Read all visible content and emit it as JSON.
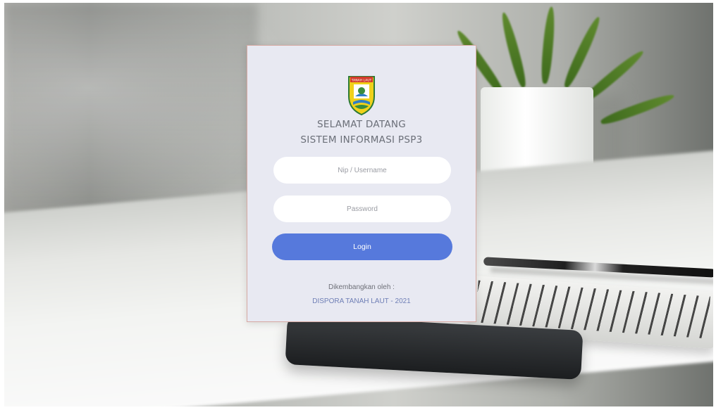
{
  "welcome": {
    "line1": "SELAMAT DATANG",
    "line2": "SISTEM INFORMASI PSP3"
  },
  "form": {
    "username_placeholder": "Nip / Username",
    "username_value": "",
    "password_placeholder": "Password",
    "password_value": "",
    "login_label": "Login"
  },
  "footer": {
    "developed_by_label": "Dikembangkan oleh :",
    "developer_link": "DISPORA TANAH LAUT - 2021"
  },
  "logo": {
    "banner_text": "TANAH LAUT"
  },
  "colors": {
    "card_background": "#e8e9f2",
    "login_button": "#5679dc",
    "title_text": "#6b6f78",
    "link_text": "#6f7fb6"
  },
  "icons": {
    "logo": "tanah-laut-regency-crest"
  }
}
